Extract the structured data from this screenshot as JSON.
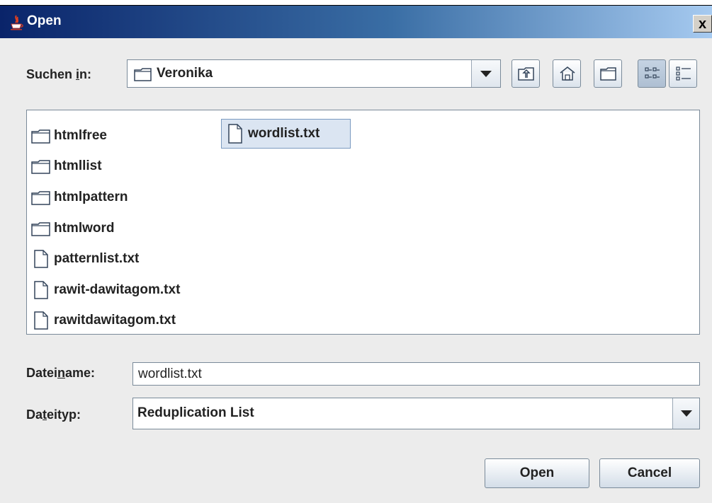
{
  "window": {
    "title": "Open",
    "close_symbol": "x"
  },
  "lookin": {
    "label": "Suchen in:",
    "value": "Veronika",
    "folder_icon": "folder-icon"
  },
  "toolbar": {
    "buttons": [
      {
        "name": "up-folder-icon"
      },
      {
        "name": "home-icon"
      },
      {
        "name": "new-folder-icon"
      },
      {
        "name": "list-view-icon",
        "active": true
      },
      {
        "name": "details-view-icon"
      }
    ]
  },
  "files": [
    {
      "name": "htmlfree",
      "type": "folder"
    },
    {
      "name": "htmllist",
      "type": "folder"
    },
    {
      "name": "htmlpattern",
      "type": "folder"
    },
    {
      "name": "htmlword",
      "type": "folder"
    },
    {
      "name": "patternlist.txt",
      "type": "file"
    },
    {
      "name": "rawit-dawitagom.txt",
      "type": "file"
    },
    {
      "name": "rawitdawitagom.txt",
      "type": "file"
    },
    {
      "name": "wordlist.txt",
      "type": "file",
      "selected": true
    }
  ],
  "filename": {
    "label": "Dateiname:",
    "value": "wordlist.txt"
  },
  "filetype": {
    "label": "Dateityp:",
    "value": "Reduplication List"
  },
  "buttons": {
    "open": "Open",
    "cancel": "Cancel"
  },
  "colors": {
    "title_start": "#0a246a",
    "title_end": "#a6caf0",
    "dialog_bg": "#ececec",
    "selection_bg": "#dbe5f2"
  }
}
